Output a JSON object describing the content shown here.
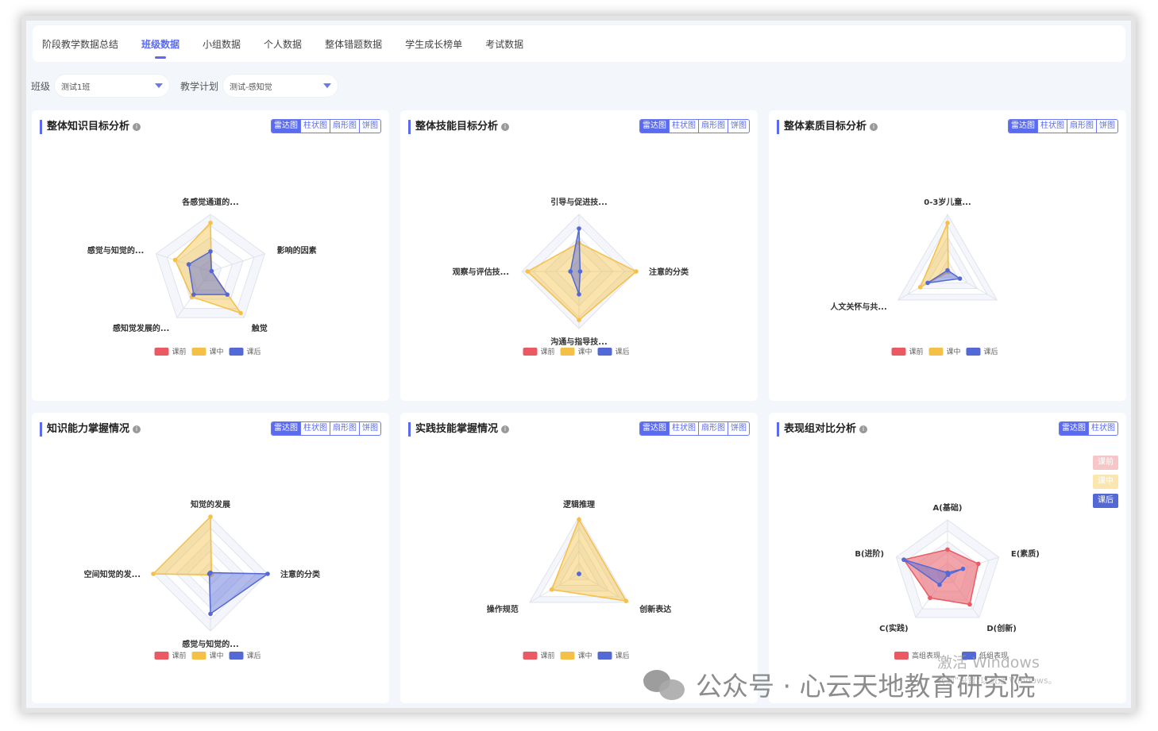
{
  "tabs": [
    "阶段教学数据总结",
    "班级数据",
    "小组数据",
    "个人数据",
    "整体错题数据",
    "学生成长榜单",
    "考试数据"
  ],
  "active_tab": 1,
  "filters": {
    "class_label": "班级",
    "class_value": "测试1班",
    "plan_label": "教学计划",
    "plan_value": "测试-感知觉"
  },
  "chart_types": [
    "雷达图",
    "柱状图",
    "扇形图",
    "饼图"
  ],
  "legend": [
    "课前",
    "课中",
    "课后"
  ],
  "colors": {
    "accent": "#5b6bf0",
    "pre": "#eb5a62",
    "mid": "#f5c048",
    "post": "#5469d4"
  },
  "cards": [
    {
      "title": "整体知识目标分析"
    },
    {
      "title": "整体技能目标分析"
    },
    {
      "title": "整体素质目标分析"
    },
    {
      "title": "知识能力掌握情况"
    },
    {
      "title": "实践技能掌握情况"
    },
    {
      "title": "表现组对比分析"
    }
  ],
  "card6_toggle": [
    "雷达图",
    "柱状图"
  ],
  "card6_side_legend": [
    "课前",
    "课中",
    "课后"
  ],
  "card6_legend": [
    "高组表现",
    "低组表现"
  ],
  "chart_data": [
    {
      "type": "radar",
      "indicators": [
        "各感觉通道的...",
        "影响的因素",
        "触觉",
        "感知觉发展的...",
        "感觉与知觉的..."
      ],
      "series": [
        {
          "name": "课中",
          "values": [
            0.85,
            0.02,
            0.9,
            0.55,
            0.65
          ]
        },
        {
          "name": "课后",
          "values": [
            0.35,
            0.02,
            0.5,
            0.5,
            0.4
          ]
        }
      ]
    },
    {
      "type": "radar",
      "indicators": [
        "引导与促进技...",
        "注意的分类",
        "沟通与指导技...",
        "观察与评估技..."
      ],
      "series": [
        {
          "name": "课中",
          "values": [
            0.5,
            1.0,
            0.85,
            0.9
          ]
        },
        {
          "name": "课后",
          "values": [
            0.75,
            0.02,
            0.4,
            0.15
          ]
        }
      ]
    },
    {
      "type": "radar",
      "indicators": [
        "0-3岁儿童...",
        "",
        "人文关怀与共..."
      ],
      "series": [
        {
          "name": "课中",
          "values": [
            0.85,
            0.02,
            0.55
          ]
        },
        {
          "name": "课后",
          "values": [
            0.02,
            0.25,
            0.4
          ]
        }
      ]
    },
    {
      "type": "radar",
      "indicators": [
        "知觉的发展",
        "注意的分类",
        "感觉与知觉的...",
        "空间知觉的发..."
      ],
      "series": [
        {
          "name": "课中",
          "values": [
            1.0,
            0.02,
            0.02,
            1.0
          ]
        },
        {
          "name": "课后",
          "values": [
            0.02,
            1.0,
            0.7,
            0.02
          ]
        }
      ]
    },
    {
      "type": "radar",
      "indicators": [
        "逻辑推理",
        "创新表达",
        "操作规范"
      ],
      "series": [
        {
          "name": "课中",
          "values": [
            0.95,
            0.95,
            0.55
          ]
        },
        {
          "name": "课后",
          "values": [
            0.0,
            0.0,
            0.0
          ]
        }
      ]
    },
    {
      "type": "radar",
      "indicators": [
        "A(基础)",
        "E(素质)",
        "D(创新)",
        "C(实践)",
        "B(进阶)"
      ],
      "series": [
        {
          "name": "高组表现",
          "values": [
            0.45,
            0.6,
            0.7,
            0.55,
            0.85
          ]
        },
        {
          "name": "低组表现",
          "values": [
            0.02,
            0.3,
            0.02,
            0.25,
            0.85
          ]
        }
      ]
    }
  ],
  "watermark": "公众号 · 心云天地教育研究院",
  "activate_text": "激活 Windows",
  "activate_sub": "转到\"设置\"以激活 Windows。"
}
